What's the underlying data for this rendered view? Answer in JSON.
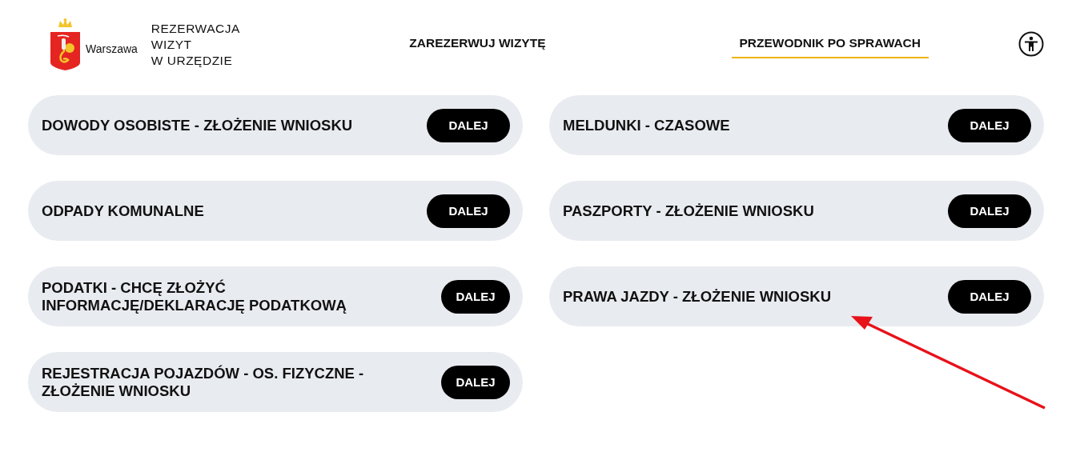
{
  "header": {
    "logo_caption": "Warszawa",
    "title_lines": [
      "REZERWACJA",
      "WIZYT",
      "W URZĘDZIE"
    ]
  },
  "nav": [
    {
      "label": "ZAREZERWUJ WIZYTĘ",
      "selected": false
    },
    {
      "label": "PRZEWODNIK PO SPRAWACH",
      "selected": true
    }
  ],
  "services": [
    {
      "title": "DOWODY OSOBISTE - ZŁOŻENIE WNIOSKU",
      "button": "DALEJ"
    },
    {
      "title": "MELDUNKI - CZASOWE",
      "button": "DALEJ"
    },
    {
      "title": "ODPADY KOMUNALNE",
      "button": "DALEJ"
    },
    {
      "title": "PASZPORTY - ZŁOŻENIE WNIOSKU",
      "button": "DALEJ"
    },
    {
      "title": "PODATKI - CHCĘ ZŁOŻYĆ INFORMACJĘ/DEKLARACJĘ PODATKOWĄ",
      "button": "DALEJ"
    },
    {
      "title": "PRAWA JAZDY - ZŁOŻENIE WNIOSKU",
      "button": "DALEJ"
    },
    {
      "title": "REJESTRACJA POJAZDÓW - OS. FIZYCZNE - ZŁOŻENIE WNIOSKU",
      "button": "DALEJ"
    }
  ]
}
